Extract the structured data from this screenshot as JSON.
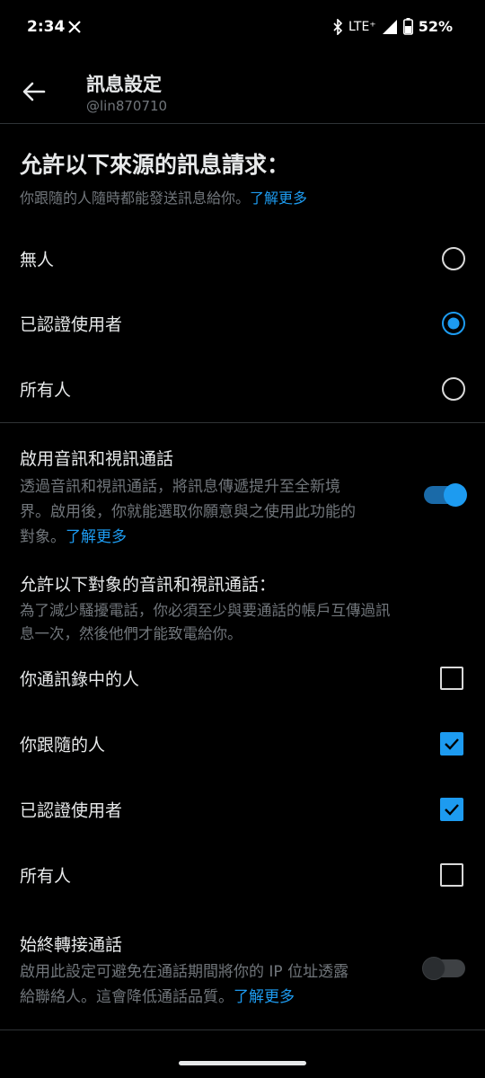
{
  "status_bar": {
    "time": "2:34",
    "network": "LTE⁺",
    "battery": "52%"
  },
  "header": {
    "title": "訊息設定",
    "handle": "@lin870710"
  },
  "message_requests": {
    "title": "允許以下來源的訊息請求：",
    "description": "你跟隨的人隨時都能發送訊息給你。",
    "learn_more": "了解更多",
    "options": [
      {
        "label": "無人",
        "selected": false
      },
      {
        "label": "已認證使用者",
        "selected": true
      },
      {
        "label": "所有人",
        "selected": false
      }
    ]
  },
  "audio_video": {
    "title": "啟用音訊和視訊通話",
    "description_lines": [
      "透過音訊和視訊通話，將訊息傳遞提升至全新境",
      "界。啟用後，你就能選取你願意與之使用此功能的",
      "對象。"
    ],
    "learn_more": "了解更多",
    "enabled": true
  },
  "call_permissions": {
    "title": "允許以下對象的音訊和視訊通話：",
    "description_lines": [
      "為了減少騷擾電話，你必須至少與要通話的帳戶互傳過訊",
      "息一次，然後他們才能致電給你。"
    ],
    "options": [
      {
        "label": "你通訊錄中的人",
        "checked": false
      },
      {
        "label": "你跟隨的人",
        "checked": true
      },
      {
        "label": "已認證使用者",
        "checked": true
      },
      {
        "label": "所有人",
        "checked": false
      }
    ]
  },
  "relay_calls": {
    "title": "始終轉接通話",
    "description_lines": [
      "啟用此設定可避免在通話期間將你的 IP 位址透露",
      "給聯絡人。這會降低通話品質。"
    ],
    "learn_more": "了解更多",
    "enabled": false
  },
  "colors": {
    "accent": "#1d9bf0",
    "background": "#000000",
    "text_primary": "#e7e9ea",
    "text_secondary": "#71767b",
    "divider": "#2f3336"
  }
}
